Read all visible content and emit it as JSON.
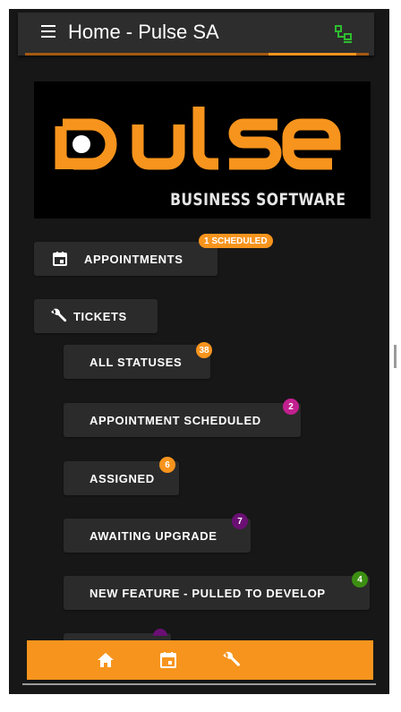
{
  "header": {
    "title": "Home - Pulse SA",
    "menu_icon": "menu-icon",
    "status_icon": "network-icon"
  },
  "logo": {
    "word": "pulse",
    "tagline": "BUSINESS SOFTWARE"
  },
  "appointments": {
    "label": "APPOINTMENTS",
    "badge": "1 SCHEDULED",
    "icon": "calendar-icon"
  },
  "tickets": {
    "label": "TICKETS",
    "icon": "wrench-icon",
    "statuses": [
      {
        "label": "ALL STATUSES",
        "count": "38"
      },
      {
        "label": "APPOINTMENT SCHEDULED",
        "count": "2"
      },
      {
        "label": "ASSIGNED",
        "count": "6"
      },
      {
        "label": "AWAITING UPGRADE",
        "count": "7"
      },
      {
        "label": "NEW FEATURE - PULLED TO DEVELOP",
        "count": "4"
      }
    ]
  },
  "bottom_nav": {
    "items": [
      "home-icon",
      "calendar-icon",
      "wrench-icon"
    ]
  },
  "colors": {
    "accent": "#f7941d",
    "badge_orange": "#f7941d",
    "badge_magenta": "#c2208f",
    "badge_purple": "#6a0f73",
    "badge_green": "#3c8f12",
    "status_green": "#2ebd2e"
  }
}
